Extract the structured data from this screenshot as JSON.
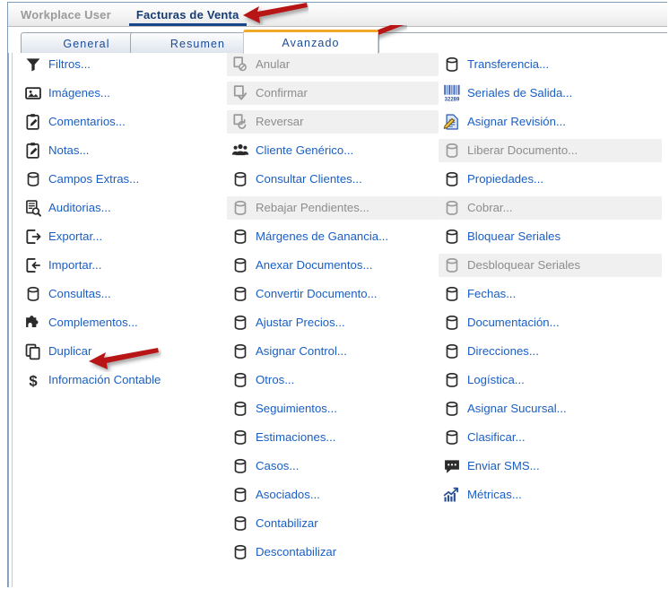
{
  "window": {
    "doc_tabs": [
      {
        "label": "Workplace User",
        "active": false
      },
      {
        "label": "Facturas de Venta",
        "active": true
      }
    ]
  },
  "inner_tabs": [
    {
      "label": "General",
      "active": false
    },
    {
      "label": "Resumen",
      "active": false
    },
    {
      "label": "Avanzado",
      "active": true
    }
  ],
  "colors": {
    "link": "#1a5fc4",
    "disabled_text": "#8d8d8d",
    "disabled_bg": "#f0f0f0",
    "active_tab_accent": "#f0a82a",
    "doc_tab_active": "#17458c",
    "arrow": "#b81414",
    "frame_border": "#7f9db9"
  },
  "columns": [
    {
      "name": "column-1",
      "items": [
        {
          "label": "Filtros...",
          "icon": "funnel-icon",
          "disabled": false
        },
        {
          "label": "Imágenes...",
          "icon": "image-icon",
          "disabled": false
        },
        {
          "label": "Comentarios...",
          "icon": "clipboard-edit-icon",
          "disabled": false
        },
        {
          "label": "Notas...",
          "icon": "clipboard-edit-icon",
          "disabled": false
        },
        {
          "label": "Campos Extras...",
          "icon": "database-icon",
          "disabled": false
        },
        {
          "label": "Auditorias...",
          "icon": "audit-search-icon",
          "disabled": false
        },
        {
          "label": "Exportar...",
          "icon": "export-icon",
          "disabled": false
        },
        {
          "label": "Importar...",
          "icon": "import-icon",
          "disabled": false
        },
        {
          "label": "Consultas...",
          "icon": "database-icon",
          "disabled": false
        },
        {
          "label": "Complementos...",
          "icon": "puzzle-icon",
          "disabled": false
        },
        {
          "label": "Duplicar",
          "icon": "copy-icon",
          "disabled": false
        },
        {
          "label": "Información Contable",
          "icon": "dollar-icon",
          "disabled": false
        }
      ]
    },
    {
      "name": "column-2",
      "items": [
        {
          "label": "Anular",
          "icon": "doc-cancel-icon",
          "disabled": true
        },
        {
          "label": "Confirmar",
          "icon": "doc-check-icon",
          "disabled": true
        },
        {
          "label": "Reversar",
          "icon": "doc-revert-icon",
          "disabled": true
        },
        {
          "label": "Cliente Genérico...",
          "icon": "people-icon",
          "disabled": false
        },
        {
          "label": "Consultar Clientes...",
          "icon": "database-icon",
          "disabled": false
        },
        {
          "label": "Rebajar Pendientes...",
          "icon": "database-icon",
          "disabled": true
        },
        {
          "label": "Márgenes de Ganancia...",
          "icon": "database-icon",
          "disabled": false
        },
        {
          "label": "Anexar Documentos...",
          "icon": "database-icon",
          "disabled": false
        },
        {
          "label": "Convertir Documento...",
          "icon": "database-icon",
          "disabled": false
        },
        {
          "label": "Ajustar Precios...",
          "icon": "database-icon",
          "disabled": false
        },
        {
          "label": "Asignar Control...",
          "icon": "database-icon",
          "disabled": false
        },
        {
          "label": "Otros...",
          "icon": "database-icon",
          "disabled": false
        },
        {
          "label": "Seguimientos...",
          "icon": "database-icon",
          "disabled": false
        },
        {
          "label": "Estimaciones...",
          "icon": "database-icon",
          "disabled": false
        },
        {
          "label": "Casos...",
          "icon": "database-icon",
          "disabled": false
        },
        {
          "label": "Asociados...",
          "icon": "database-icon",
          "disabled": false
        },
        {
          "label": "Contabilizar",
          "icon": "database-icon",
          "disabled": false
        },
        {
          "label": "Descontabilizar",
          "icon": "database-icon",
          "disabled": false
        }
      ]
    },
    {
      "name": "column-3",
      "items": [
        {
          "label": "Transferencia...",
          "icon": "database-icon",
          "disabled": false
        },
        {
          "label": "Seriales de Salida...",
          "icon": "barcode-icon",
          "disabled": false
        },
        {
          "label": "Asignar Revisión...",
          "icon": "doc-pencil-icon",
          "disabled": false
        },
        {
          "label": "Liberar Documento...",
          "icon": "database-icon",
          "disabled": true
        },
        {
          "label": "Propiedades...",
          "icon": "database-icon",
          "disabled": false
        },
        {
          "label": "Cobrar...",
          "icon": "database-icon",
          "disabled": true
        },
        {
          "label": "Bloquear Seriales",
          "icon": "database-icon",
          "disabled": false
        },
        {
          "label": "Desbloquear Seriales",
          "icon": "database-icon",
          "disabled": true
        },
        {
          "label": "Fechas...",
          "icon": "database-icon",
          "disabled": false
        },
        {
          "label": "Documentación...",
          "icon": "database-icon",
          "disabled": false
        },
        {
          "label": "Direcciones...",
          "icon": "database-icon",
          "disabled": false
        },
        {
          "label": "Logística...",
          "icon": "database-icon",
          "disabled": false
        },
        {
          "label": "Asignar Sucursal...",
          "icon": "database-icon",
          "disabled": false
        },
        {
          "label": "Clasificar...",
          "icon": "database-icon",
          "disabled": false
        },
        {
          "label": "Enviar SMS...",
          "icon": "sms-bubble-icon",
          "disabled": false
        },
        {
          "label": "Métricas...",
          "icon": "metrics-chart-icon",
          "disabled": false
        }
      ]
    }
  ],
  "annotations": [
    {
      "name": "arrow-to-facturas-tab",
      "icon": "arrow-left-icon"
    },
    {
      "name": "arrow-to-avanzado-tab",
      "icon": "arrow-left-icon"
    },
    {
      "name": "arrow-to-duplicar",
      "icon": "arrow-left-icon"
    }
  ],
  "barcode_icon_digits": "32289"
}
